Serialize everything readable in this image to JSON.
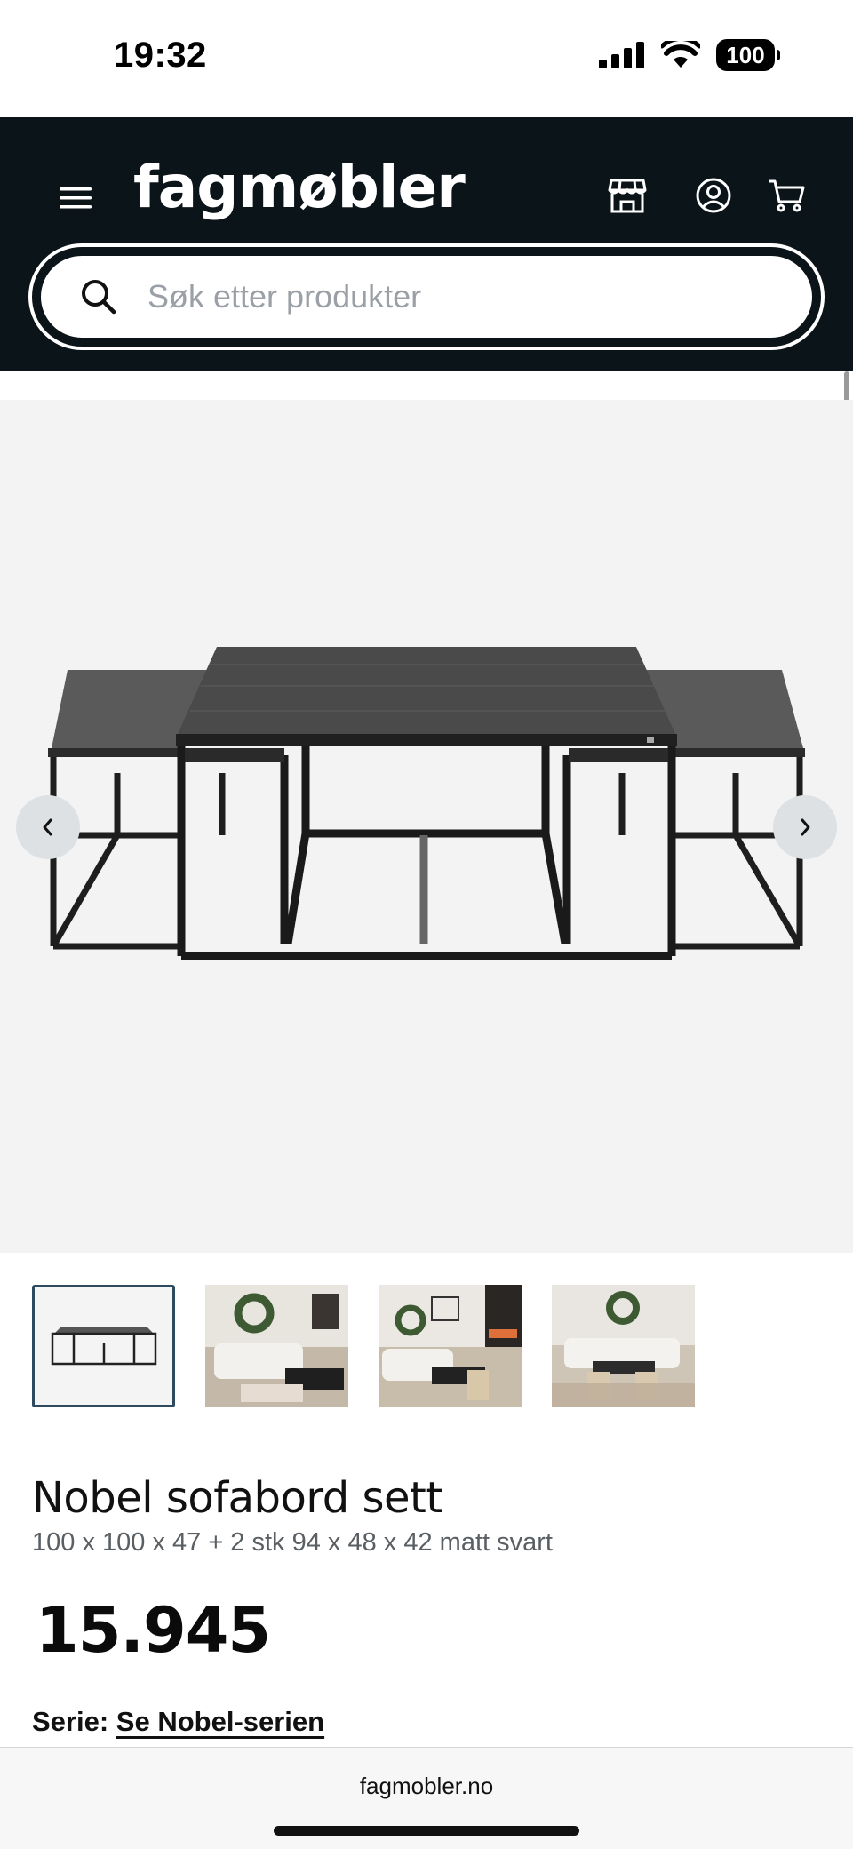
{
  "status_bar": {
    "time": "19:32",
    "battery": "100"
  },
  "header": {
    "logo": "fagmøbler",
    "search_placeholder": "Søk etter produkter",
    "icons": [
      "menu-icon",
      "store-icon",
      "account-icon",
      "cart-icon"
    ]
  },
  "product": {
    "title": "Nobel sofabord sett",
    "subtitle": "100 x 100 x 47 + 2 stk 94 x 48 x 42 matt svart",
    "price": "15.945",
    "series_label": "Serie:",
    "series_link": "Se Nobel-serien"
  },
  "gallery": {
    "thumbnail_count": 4,
    "active_index": 0,
    "arrows": [
      "chevron-left-icon",
      "chevron-right-icon"
    ]
  },
  "browser": {
    "url": "fagmobler.no"
  },
  "colors": {
    "header_bg": "#0b1418",
    "gallery_bg": "#f3f3f3",
    "active_thumb_border": "#2d4a5e"
  }
}
